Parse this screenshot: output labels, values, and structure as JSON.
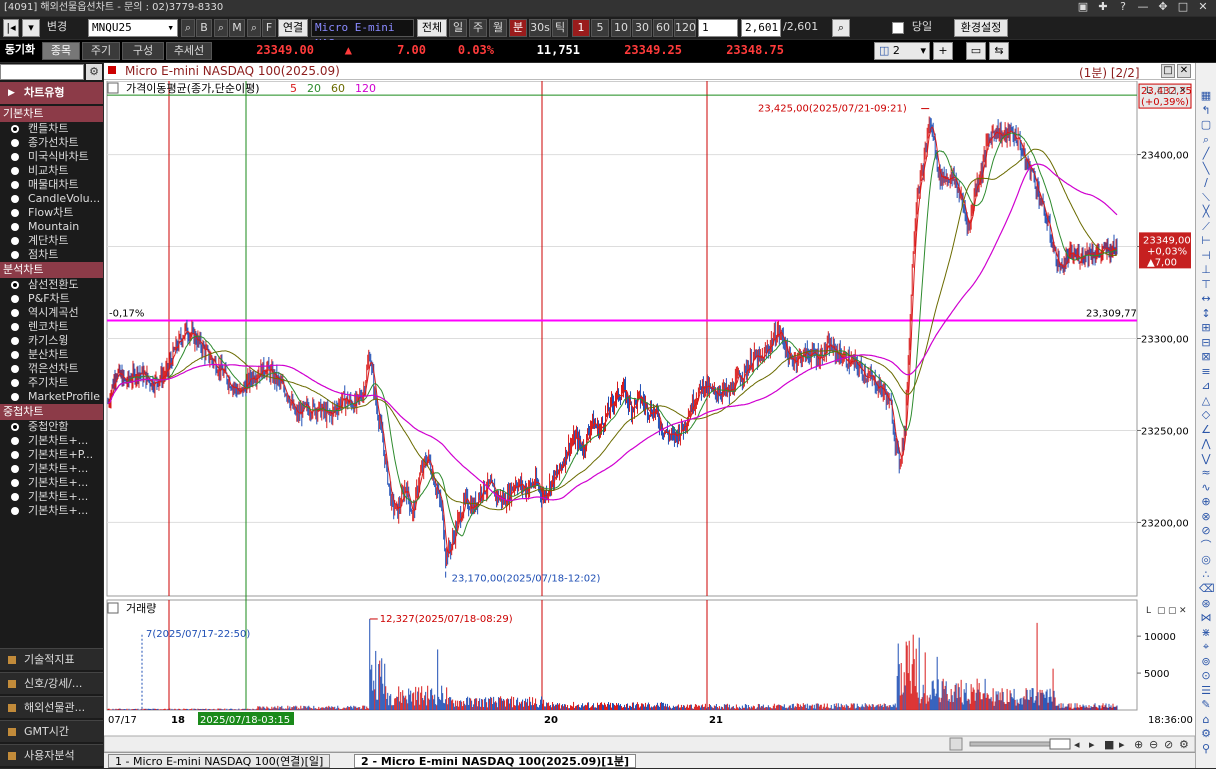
{
  "window": {
    "title": "[4091] 해외선물옵션차트 - 문의 : 02)3779-8330"
  },
  "toolbar": {
    "change_label": "변경",
    "symbol": "MNQU25",
    "btn_b": "B",
    "btn_m": "M",
    "btn_f": "F",
    "link_label": "연결",
    "symbol_name": "Micro E-mini NAS",
    "all_label": "전체",
    "periods": [
      "일",
      "주",
      "월",
      "분",
      "30s",
      "틱"
    ],
    "intervals": [
      "1",
      "5",
      "10",
      "30",
      "60",
      "120"
    ],
    "interval_value": "1",
    "count_value": "2,601",
    "count_total": "2,601",
    "today_label": "당일",
    "settings_label": "환경설정"
  },
  "toolbar2": {
    "sync_label": "동기화",
    "tabs": [
      "종목",
      "주기",
      "구성",
      "추세선"
    ],
    "price": "23349.00",
    "change": "7.00",
    "change_pct": "0.03%",
    "volume": "11,751",
    "ask": "23349.25",
    "bid": "23348.75",
    "layout_value": "2"
  },
  "sidebar": {
    "header": "차트유형",
    "sections": [
      {
        "title": "기본차트",
        "items": [
          "캔들차트",
          "종가선차트",
          "미국식바차트",
          "비교차트",
          "매물대차트",
          "CandleVolu...",
          "Flow차트",
          "Mountain",
          "계단차트",
          "점차트"
        ]
      },
      {
        "title": "분석차트",
        "items": [
          "삼선전환도",
          "P&F차트",
          "역시계곡선",
          "렌코차트",
          "카기스윙",
          "분산차트",
          "꺾은선차트",
          "주기차트",
          "MarketProfile"
        ]
      },
      {
        "title": "중첩차트",
        "items": [
          "중첩안함",
          "기본차트+...",
          "기본차트+P...",
          "기본차트+...",
          "기본차트+...",
          "기본차트+...",
          "기본차트+..."
        ]
      }
    ],
    "bottom": [
      "기술적지표",
      "신호/강세/...",
      "해외선물관...",
      "GMT시간",
      "사용자분석"
    ]
  },
  "chart": {
    "title": "Micro E-mini NASDAQ 100(2025.09)",
    "period_label": "(1분) [2/2]",
    "ma_label": "가격이동평균(종가,단순이평)",
    "ma_periods": [
      "5",
      "20",
      "60",
      "120"
    ],
    "volume_label": "거래량",
    "time_label": "18:36:00",
    "date_left": "07/17",
    "crosshair_date": "2025/07/18-03:15"
  },
  "colors": {
    "up": "#d81b1b",
    "down": "#1f4fb5",
    "ma5": "#d81b1b",
    "ma20": "#2e8b2e",
    "ma60": "#6b6b00",
    "ma120": "#d000d0",
    "ref": "#ff00ff"
  },
  "chart_data": {
    "type": "candlestick",
    "title": "Micro E-mini NASDAQ 100(2025.09)",
    "ylim": [
      23160,
      23440
    ],
    "yticks": [
      23200,
      23250,
      23300,
      23350,
      23400
    ],
    "ytick_labels": [
      "23200,00",
      "23250,00",
      "23300,00",
      "23350,00",
      "23400,00"
    ],
    "x_labels": [
      "07/17",
      "18",
      "20",
      "21"
    ],
    "last_price": {
      "value": "23349,00",
      "change_pct": "+0,03%",
      "change": "▲7,00"
    },
    "high_tag": {
      "value": "23,432,35",
      "pct": "(+0,39%)"
    },
    "reference_line": {
      "value": 23309.77,
      "label": "23,309,77",
      "pct_label": "-0,17%"
    },
    "annotations": {
      "high": "23,425,00(2025/07/21-09:21)",
      "low": "23,170,00(2025/07/18-12:02)",
      "vol_max": "12,327(2025/07/18-08:29)",
      "vol_min": "7(2025/07/17-22:50)"
    },
    "close_path": [
      [
        0,
        23265
      ],
      [
        8,
        23282
      ],
      [
        18,
        23276
      ],
      [
        30,
        23282
      ],
      [
        45,
        23276
      ],
      [
        58,
        23281
      ],
      [
        68,
        23295
      ],
      [
        78,
        23305
      ],
      [
        88,
        23300
      ],
      [
        100,
        23291
      ],
      [
        110,
        23285
      ],
      [
        120,
        23278
      ],
      [
        132,
        23270
      ],
      [
        145,
        23280
      ],
      [
        158,
        23284
      ],
      [
        170,
        23277
      ],
      [
        180,
        23270
      ],
      [
        188,
        23258
      ],
      [
        198,
        23262
      ],
      [
        210,
        23262
      ],
      [
        222,
        23258
      ],
      [
        235,
        23267
      ],
      [
        248,
        23264
      ],
      [
        256,
        23272
      ],
      [
        262,
        23292
      ],
      [
        268,
        23265
      ],
      [
        272,
        23255
      ],
      [
        278,
        23232
      ],
      [
        284,
        23210
      ],
      [
        290,
        23206
      ],
      [
        298,
        23220
      ],
      [
        305,
        23204
      ],
      [
        312,
        23225
      ],
      [
        320,
        23236
      ],
      [
        328,
        23220
      ],
      [
        334,
        23208
      ],
      [
        338,
        23182
      ],
      [
        344,
        23188
      ],
      [
        350,
        23200
      ],
      [
        358,
        23212
      ],
      [
        366,
        23208
      ],
      [
        374,
        23218
      ],
      [
        382,
        23220
      ],
      [
        390,
        23214
      ],
      [
        398,
        23212
      ],
      [
        408,
        23222
      ],
      [
        418,
        23218
      ],
      [
        428,
        23222
      ],
      [
        436,
        23214
      ],
      [
        444,
        23222
      ],
      [
        452,
        23228
      ],
      [
        460,
        23240
      ],
      [
        468,
        23246
      ],
      [
        476,
        23240
      ],
      [
        484,
        23255
      ],
      [
        492,
        23250
      ],
      [
        500,
        23260
      ],
      [
        508,
        23268
      ],
      [
        516,
        23272
      ],
      [
        524,
        23262
      ],
      [
        532,
        23268
      ],
      [
        540,
        23262
      ],
      [
        548,
        23260
      ],
      [
        556,
        23250
      ],
      [
        566,
        23246
      ],
      [
        576,
        23252
      ],
      [
        586,
        23266
      ],
      [
        596,
        23275
      ],
      [
        606,
        23270
      ],
      [
        614,
        23272
      ],
      [
        622,
        23270
      ],
      [
        630,
        23278
      ],
      [
        638,
        23282
      ],
      [
        646,
        23290
      ],
      [
        654,
        23288
      ],
      [
        662,
        23296
      ],
      [
        670,
        23304
      ],
      [
        676,
        23300
      ],
      [
        682,
        23288
      ],
      [
        692,
        23290
      ],
      [
        702,
        23292
      ],
      [
        712,
        23290
      ],
      [
        722,
        23296
      ],
      [
        730,
        23292
      ],
      [
        740,
        23288
      ],
      [
        748,
        23286
      ],
      [
        756,
        23282
      ],
      [
        764,
        23278
      ],
      [
        772,
        23274
      ],
      [
        778,
        23270
      ],
      [
        784,
        23262
      ],
      [
        788,
        23245
      ],
      [
        792,
        23232
      ],
      [
        798,
        23252
      ],
      [
        802,
        23300
      ],
      [
        806,
        23350
      ],
      [
        810,
        23380
      ],
      [
        816,
        23392
      ],
      [
        822,
        23418
      ],
      [
        826,
        23410
      ],
      [
        832,
        23388
      ],
      [
        840,
        23388
      ],
      [
        848,
        23386
      ],
      [
        856,
        23372
      ],
      [
        862,
        23360
      ],
      [
        868,
        23382
      ],
      [
        874,
        23390
      ],
      [
        880,
        23406
      ],
      [
        888,
        23414
      ],
      [
        896,
        23410
      ],
      [
        904,
        23412
      ],
      [
        912,
        23408
      ],
      [
        918,
        23396
      ],
      [
        924,
        23392
      ],
      [
        930,
        23382
      ],
      [
        936,
        23370
      ],
      [
        942,
        23360
      ],
      [
        948,
        23345
      ],
      [
        954,
        23338
      ],
      [
        962,
        23345
      ],
      [
        972,
        23345
      ],
      [
        982,
        23347
      ],
      [
        992,
        23346
      ],
      [
        1000,
        23348
      ],
      [
        1010,
        23349
      ]
    ],
    "volume": {
      "ylim": [
        0,
        13000
      ],
      "yticks": [
        5000,
        10000
      ],
      "ytick_labels": [
        "5000",
        "10000"
      ],
      "segments": [
        [
          0,
          150,
          120
        ],
        [
          150,
          262,
          350
        ],
        [
          262,
          278,
          4500
        ],
        [
          278,
          340,
          2000
        ],
        [
          340,
          440,
          1100
        ],
        [
          440,
          560,
          650
        ],
        [
          560,
          680,
          500
        ],
        [
          680,
          790,
          550
        ],
        [
          790,
          810,
          6000
        ],
        [
          810,
          880,
          2500
        ],
        [
          880,
          950,
          1800
        ],
        [
          950,
          1010,
          550
        ]
      ],
      "spikes": [
        [
          262,
          12327
        ],
        [
          268,
          8000
        ],
        [
          274,
          7000
        ],
        [
          330,
          8200
        ],
        [
          806,
          10200
        ],
        [
          812,
          9800
        ],
        [
          818,
          7800
        ],
        [
          830,
          7200
        ],
        [
          930,
          11800
        ],
        [
          946,
          5600
        ]
      ]
    }
  }
}
